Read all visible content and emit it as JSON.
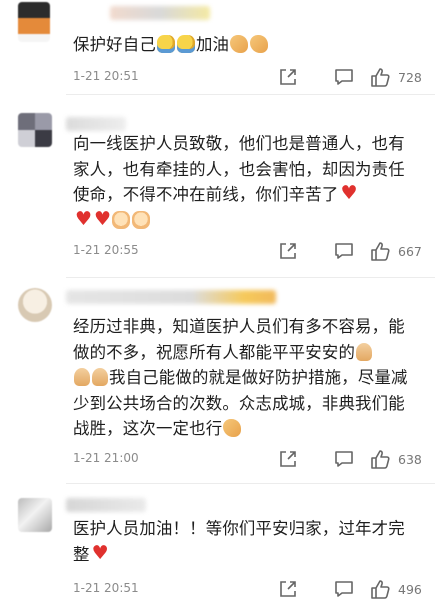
{
  "comments": [
    {
      "text_main": "保护好自己",
      "text_tail": "加油",
      "time": "1-21 20:51",
      "likes": "728",
      "emojis_after_main": [
        "medical-mask-face",
        "medical-mask-face"
      ],
      "emojis_after_tail": [
        "flexed-biceps",
        "flexed-biceps"
      ]
    },
    {
      "text_main": "向一线医护人员致敬，他们也是普通人，也有家人，也有牵挂的人，也会害怕，却因为责任使命，不得不冲在前线，你们辛苦了",
      "time": "1-21 20:55",
      "likes": "667",
      "emojis_after_main": [
        "red-heart",
        "red-heart",
        "red-heart",
        "hug",
        "hug"
      ]
    },
    {
      "text_a": "经历过非典，知道医护人员们有多不容易，能做的不多，祝愿所有人都能平平安安的",
      "text_b": "我自己能做的就是做好防护措施，尽量减少到公共场合的次数。众志成城，非典我们能战胜，这次一定也行",
      "time": "1-21 21:00",
      "likes": "638",
      "emojis_mid": [
        "pray",
        "pray",
        "pray"
      ],
      "emojis_end": [
        "flexed-biceps"
      ]
    },
    {
      "text_main": "医护人员加油！！等你们平安归家，过年才完整",
      "time": "1-21 20:51",
      "likes": "496",
      "emojis_end": [
        "red-heart"
      ]
    }
  ],
  "icons": {
    "share": "share-arrow-icon",
    "reply": "reply-bubble-icon",
    "like": "thumbs-up-icon"
  },
  "colors": {
    "meta_text": "#8b8b8b",
    "divider": "#ececec",
    "heart": "#e0312e"
  }
}
